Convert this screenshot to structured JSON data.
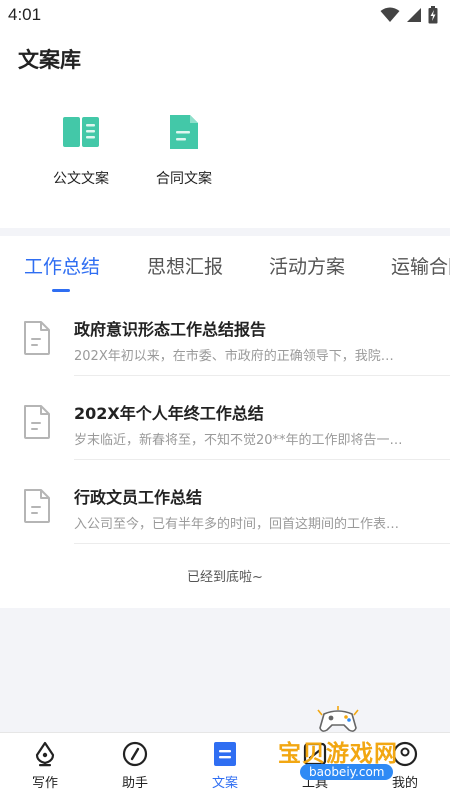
{
  "status_bar": {
    "time": "4:01",
    "icons": [
      "wifi-icon",
      "signal-icon",
      "battery-icon"
    ]
  },
  "header": {
    "title": "文案库"
  },
  "categories": [
    {
      "label": "公文文案",
      "icon": "book-icon",
      "color": "#43c8a8"
    },
    {
      "label": "合同文案",
      "icon": "document-icon",
      "color": "#43c8a8"
    }
  ],
  "tabs": [
    {
      "label": "工作总结",
      "active": true
    },
    {
      "label": "思想汇报",
      "active": false
    },
    {
      "label": "活动方案",
      "active": false
    },
    {
      "label": "运输合同",
      "active": false
    }
  ],
  "articles": [
    {
      "title": "政府意识形态工作总结报告",
      "summary": "202X年初以来，在市委、市政府的正确领导下，我院…"
    },
    {
      "title": "202X年个人年终工作总结",
      "summary": "岁末临近，新春将至，不知不觉20**年的工作即将告一…"
    },
    {
      "title": "行政文员工作总结",
      "summary": "入公司至今，已有半年多的时间，回首这期间的工作表…"
    }
  ],
  "list_end_text": "已经到底啦~",
  "bottom_nav": [
    {
      "label": "写作",
      "icon": "pen-nib-icon",
      "active": false
    },
    {
      "label": "助手",
      "icon": "compass-icon",
      "active": false
    },
    {
      "label": "文案",
      "icon": "document-icon",
      "active": true
    },
    {
      "label": "工具",
      "icon": "tools-icon",
      "active": false
    },
    {
      "label": "我的",
      "icon": "user-icon",
      "active": false
    }
  ],
  "watermark": {
    "text": "宝贝游戏网",
    "url": "baobeiy.com"
  },
  "colors": {
    "accent": "#2f6ef2",
    "category_icon": "#43c8a8",
    "background": "#f3f4f8",
    "watermark_text": "#f2a712",
    "watermark_badge": "#2f8af5"
  }
}
